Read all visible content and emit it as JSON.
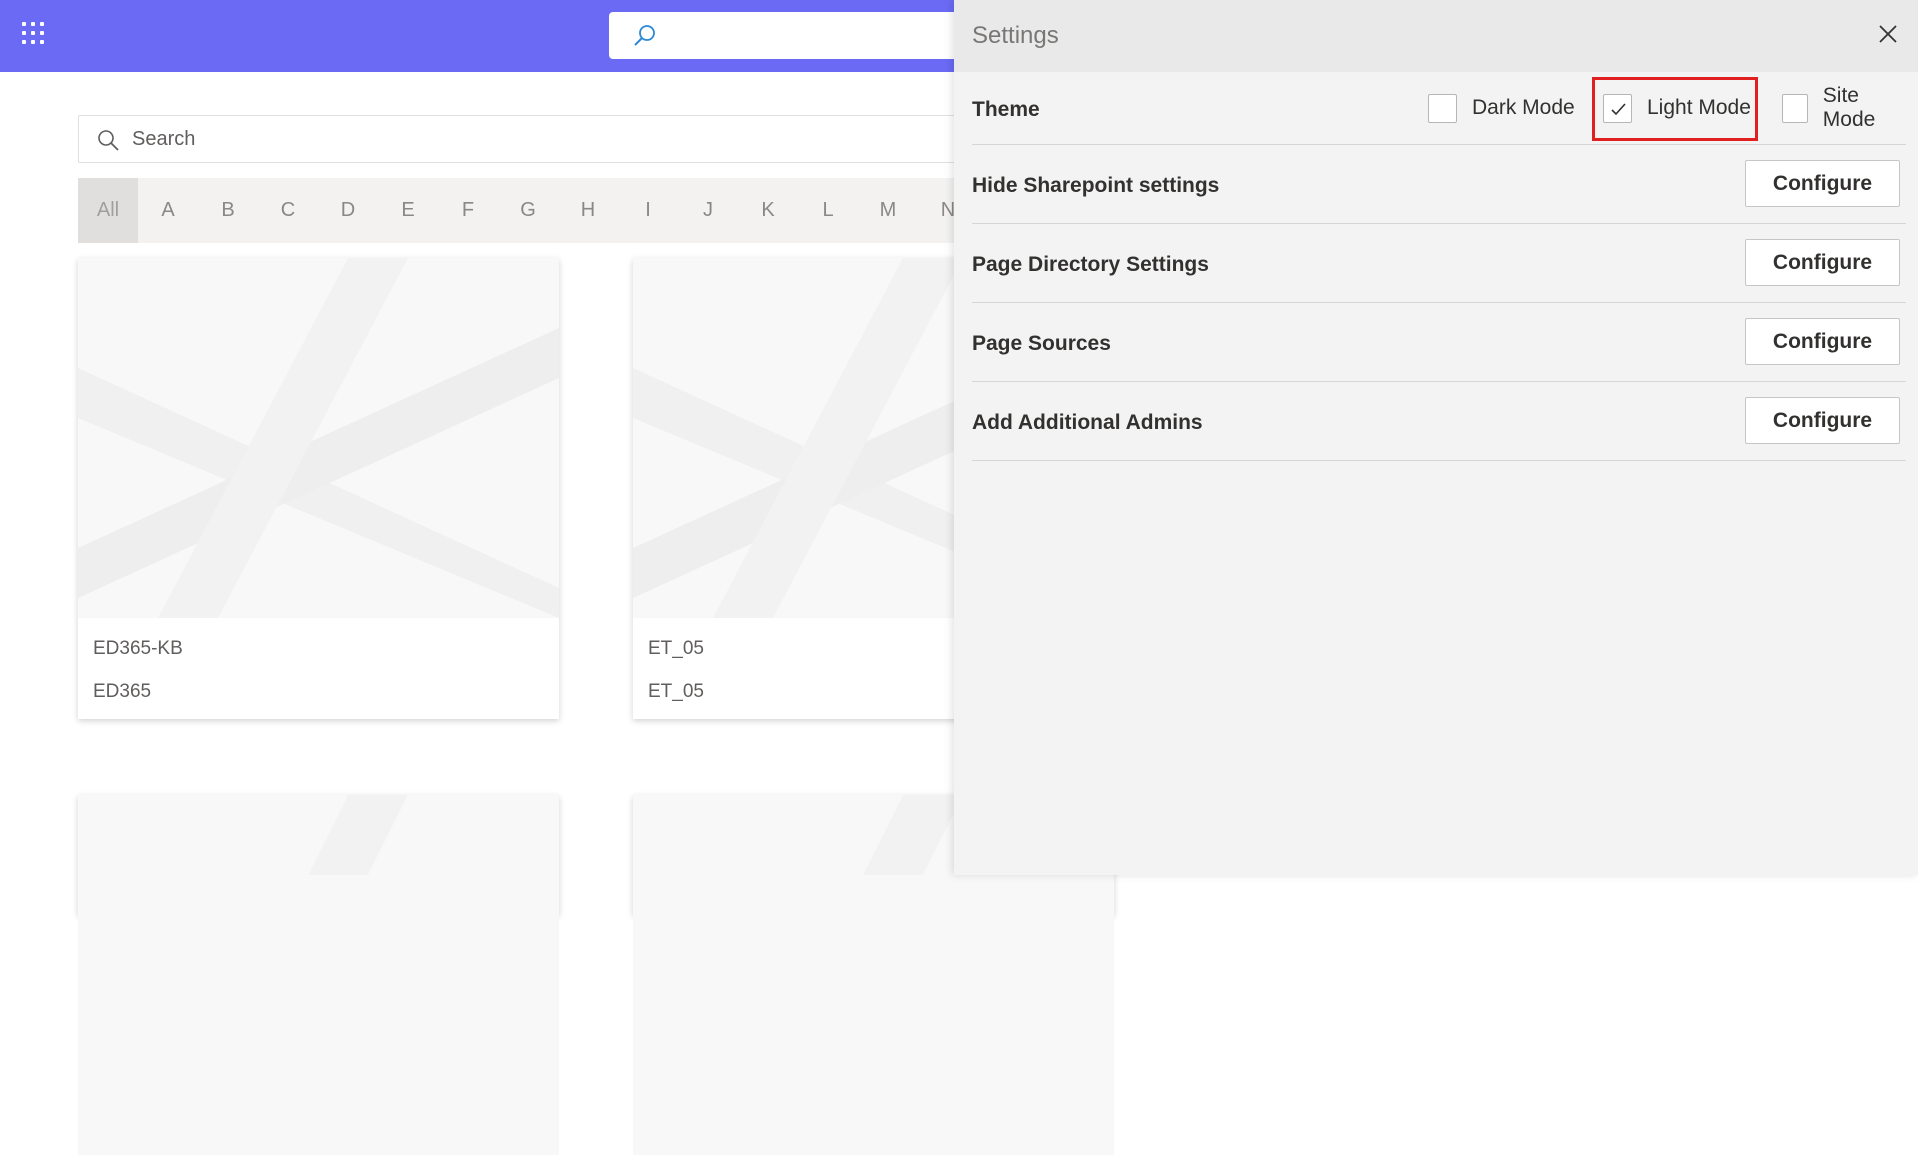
{
  "topbar": {
    "app_launcher_icon": "waffle-icon",
    "search_icon": "search-icon"
  },
  "content": {
    "search": {
      "placeholder": "Search"
    },
    "alphabet": [
      "All",
      "A",
      "B",
      "C",
      "D",
      "E",
      "F",
      "G",
      "H",
      "I",
      "J",
      "K",
      "L",
      "M",
      "N"
    ],
    "active_letter": "All",
    "cards": [
      {
        "title": "ED365-KB",
        "subtitle": "ED365"
      },
      {
        "title": "ET_05",
        "subtitle": "ET_05"
      }
    ]
  },
  "settings": {
    "title": "Settings",
    "close_icon": "close-icon",
    "theme": {
      "label": "Theme",
      "options": [
        {
          "label": "Dark Mode",
          "checked": false
        },
        {
          "label": "Light Mode",
          "checked": true
        },
        {
          "label": "Site Mode",
          "checked": false
        }
      ]
    },
    "rows": [
      {
        "label": "Hide Sharepoint settings",
        "button": "Configure"
      },
      {
        "label": "Page Directory Settings",
        "button": "Configure"
      },
      {
        "label": "Page Sources",
        "button": "Configure"
      },
      {
        "label": "Add Additional Admins",
        "button": "Configure"
      }
    ],
    "highlight_color": "#e02020",
    "accent": "#6a6af4"
  }
}
